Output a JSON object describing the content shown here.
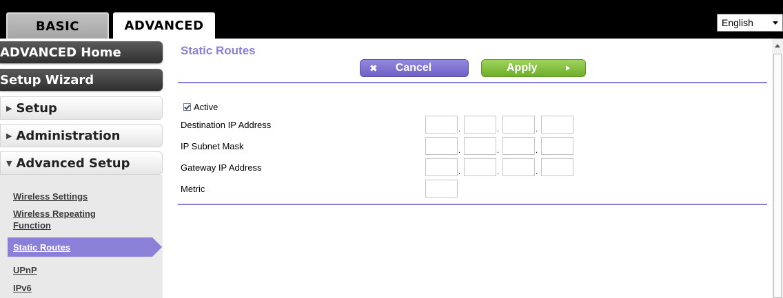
{
  "tabs": {
    "basic": "BASIC",
    "advanced": "ADVANCED"
  },
  "language": {
    "selected": "English"
  },
  "sidebar": {
    "advanced_home": "ADVANCED Home",
    "setup_wizard": "Setup Wizard",
    "setup": "Setup",
    "administration": "Administration",
    "advanced_setup": "Advanced Setup",
    "submenu": {
      "wireless_settings": "Wireless Settings",
      "wireless_repeating_line1": "Wireless Repeating",
      "wireless_repeating_line2": "Function",
      "static_routes": "Static Routes",
      "upnp": "UPnP",
      "ipv6": "IPv6"
    }
  },
  "main": {
    "title": "Static Routes",
    "cancel_label": "Cancel",
    "apply_label": "Apply",
    "active_label": "Active",
    "active_checked": true,
    "fields": {
      "destination_ip": "Destination IP Address",
      "subnet_mask": "IP Subnet Mask",
      "gateway_ip": "Gateway IP Address",
      "metric": "Metric"
    }
  },
  "colors": {
    "accent": "#8b80d8",
    "apply_green": "#86c244",
    "topbar": "#000000"
  },
  "icons": {
    "cancel": "close-icon",
    "apply": "arrow-right-icon",
    "collapsed": "triangle-right-icon",
    "expanded": "triangle-down-icon"
  }
}
